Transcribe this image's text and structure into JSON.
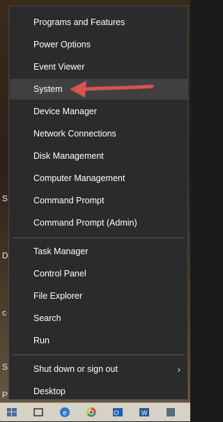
{
  "desktop": {
    "fragments": [
      "S",
      "D",
      "c",
      "S",
      "P"
    ]
  },
  "menu": {
    "items": [
      {
        "label": "Programs and Features"
      },
      {
        "label": "Power Options"
      },
      {
        "label": "Event Viewer"
      },
      {
        "label": "System"
      },
      {
        "label": "Device Manager"
      },
      {
        "label": "Network Connections"
      },
      {
        "label": "Disk Management"
      },
      {
        "label": "Computer Management"
      },
      {
        "label": "Command Prompt"
      },
      {
        "label": "Command Prompt (Admin)"
      },
      {
        "label": "Task Manager"
      },
      {
        "label": "Control Panel"
      },
      {
        "label": "File Explorer"
      },
      {
        "label": "Search"
      },
      {
        "label": "Run"
      },
      {
        "label": "Shut down or sign out"
      },
      {
        "label": "Desktop"
      }
    ],
    "selected": "System",
    "submenu_icon": "chevron-right-icon"
  },
  "annotation": {
    "icon": "red-arrow-icon",
    "color": "#d9534f"
  },
  "taskbar": {
    "icons": [
      "start-icon",
      "task-view-icon",
      "edge-icon",
      "chrome-icon",
      "outlook-icon",
      "word-icon",
      "app-icon"
    ]
  }
}
